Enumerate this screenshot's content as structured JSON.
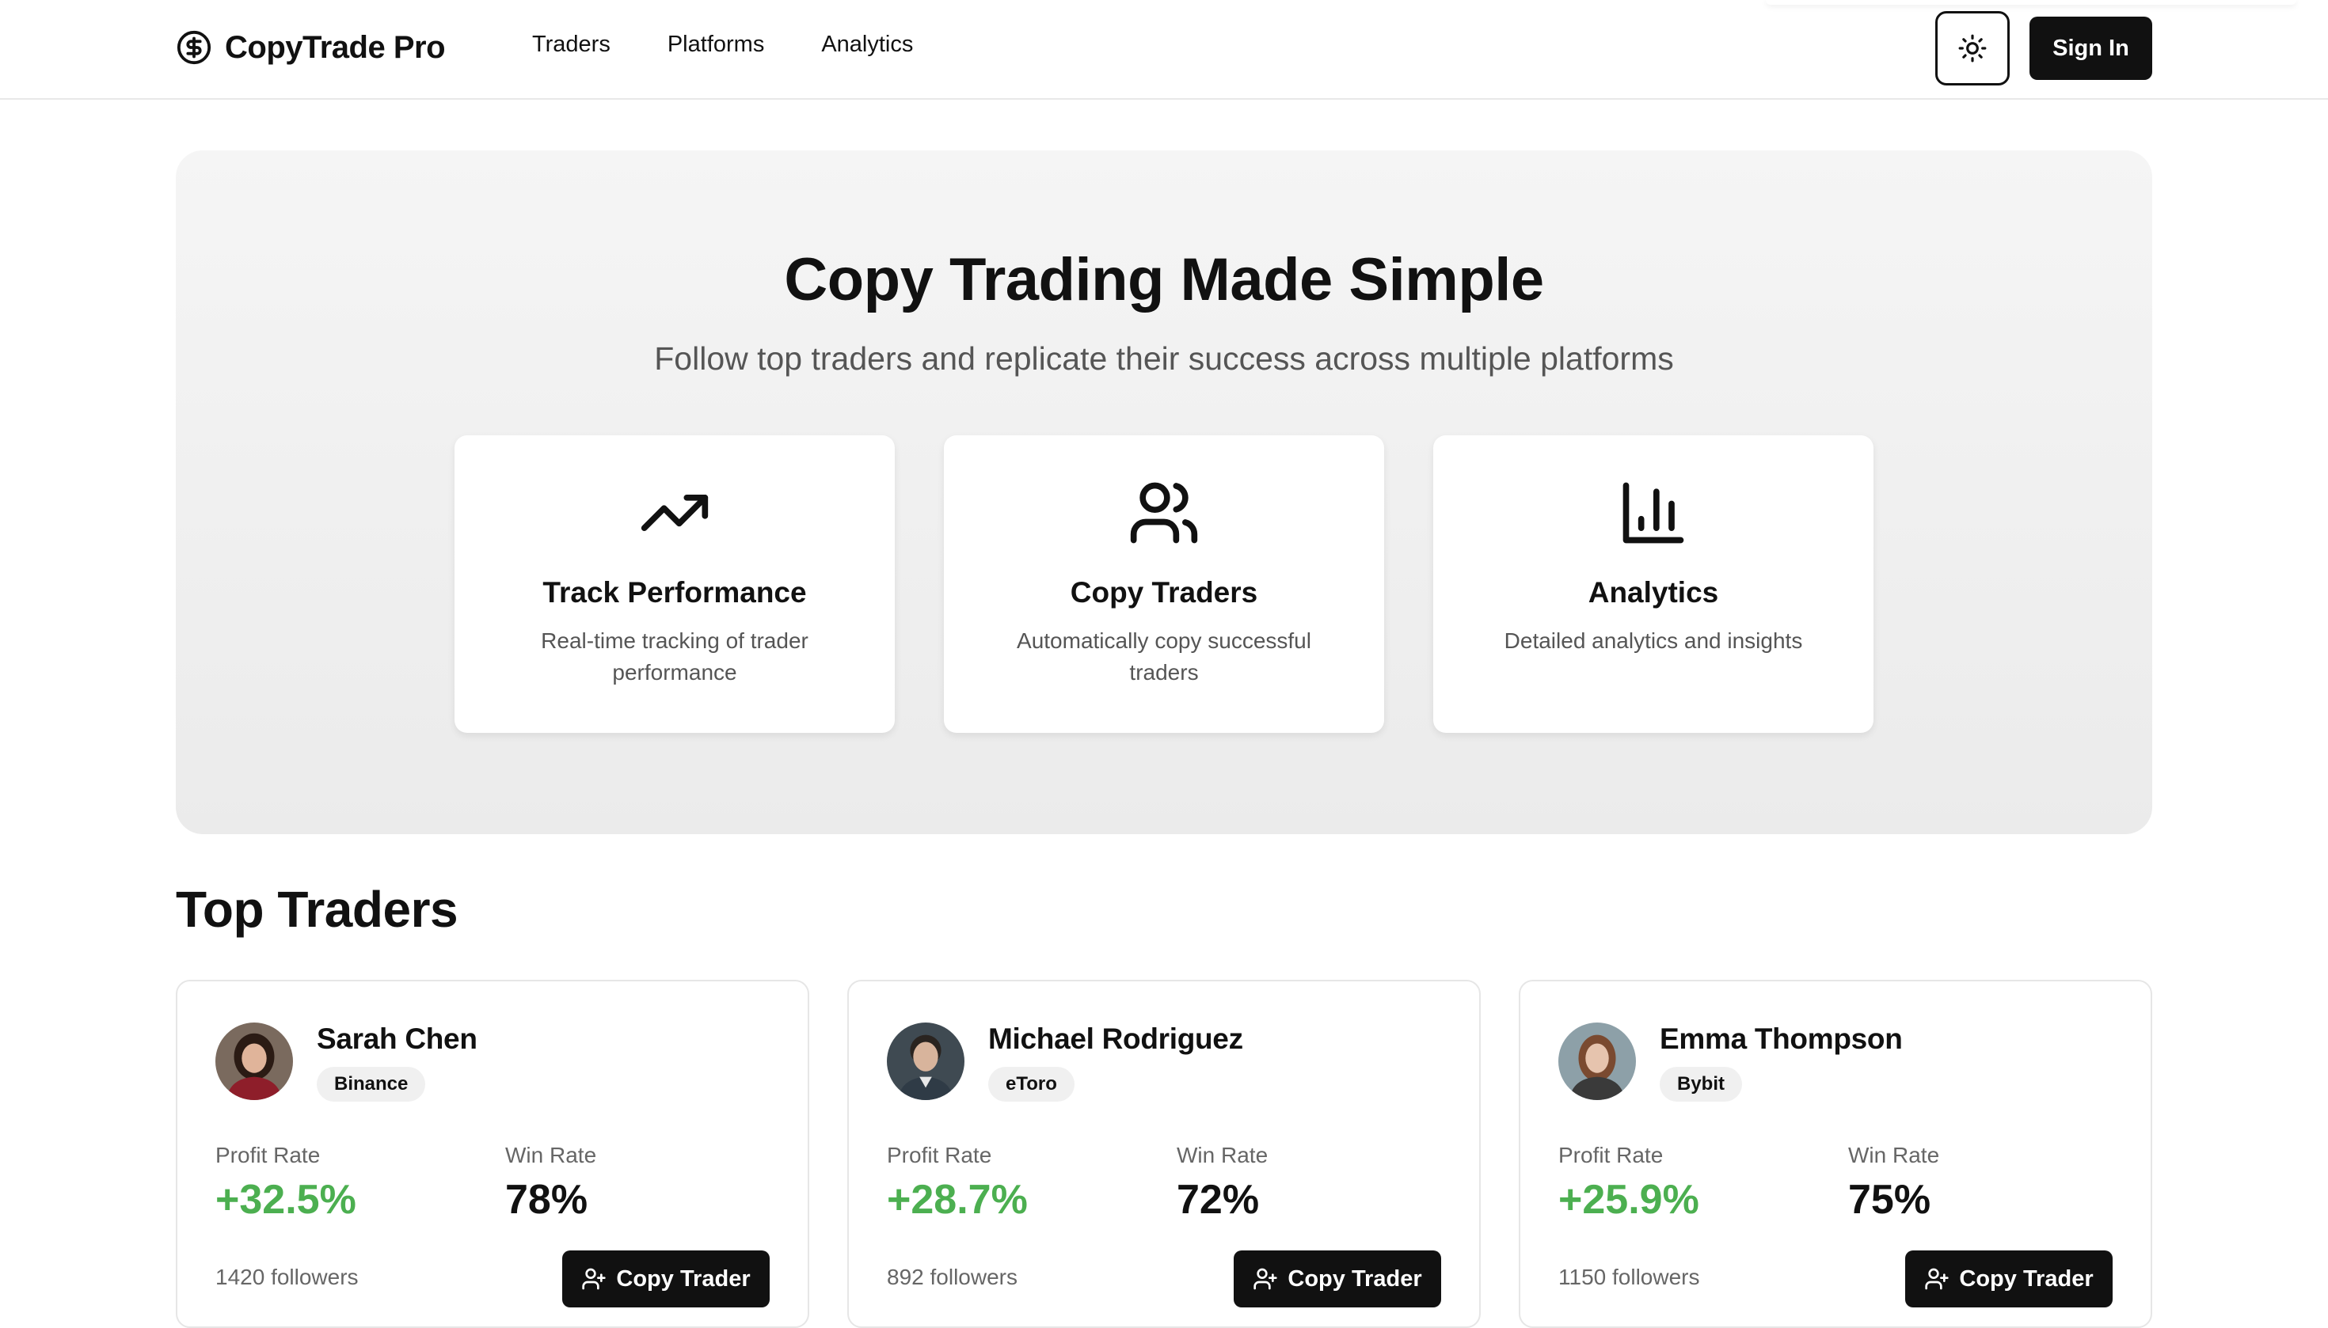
{
  "header": {
    "brand": "CopyTrade Pro",
    "nav": [
      "Traders",
      "Platforms",
      "Analytics"
    ],
    "sign_in": "Sign In",
    "theme_icon": "sun-icon"
  },
  "hero": {
    "title": "Copy Trading Made Simple",
    "subtitle": "Follow top traders and replicate their success across multiple platforms",
    "features": [
      {
        "icon": "trending-up-icon",
        "title": "Track Performance",
        "desc": "Real-time tracking of trader performance"
      },
      {
        "icon": "users-icon",
        "title": "Copy Traders",
        "desc": "Automatically copy successful traders"
      },
      {
        "icon": "bar-chart-icon",
        "title": "Analytics",
        "desc": "Detailed analytics and insights"
      }
    ]
  },
  "top_traders": {
    "title": "Top Traders",
    "profit_label": "Profit Rate",
    "win_label": "Win Rate",
    "copy_label": "Copy Trader",
    "traders": [
      {
        "name": "Sarah Chen",
        "platform": "Binance",
        "profit": "+32.5%",
        "win_rate": "78%",
        "followers": "1420 followers"
      },
      {
        "name": "Michael Rodriguez",
        "platform": "eToro",
        "profit": "+28.7%",
        "win_rate": "72%",
        "followers": "892 followers"
      },
      {
        "name": "Emma Thompson",
        "platform": "Bybit",
        "profit": "+25.9%",
        "win_rate": "75%",
        "followers": "1150 followers"
      }
    ]
  },
  "colors": {
    "profit_green": "#4caf50",
    "primary": "#111111",
    "hero_bg": "#efefef"
  }
}
